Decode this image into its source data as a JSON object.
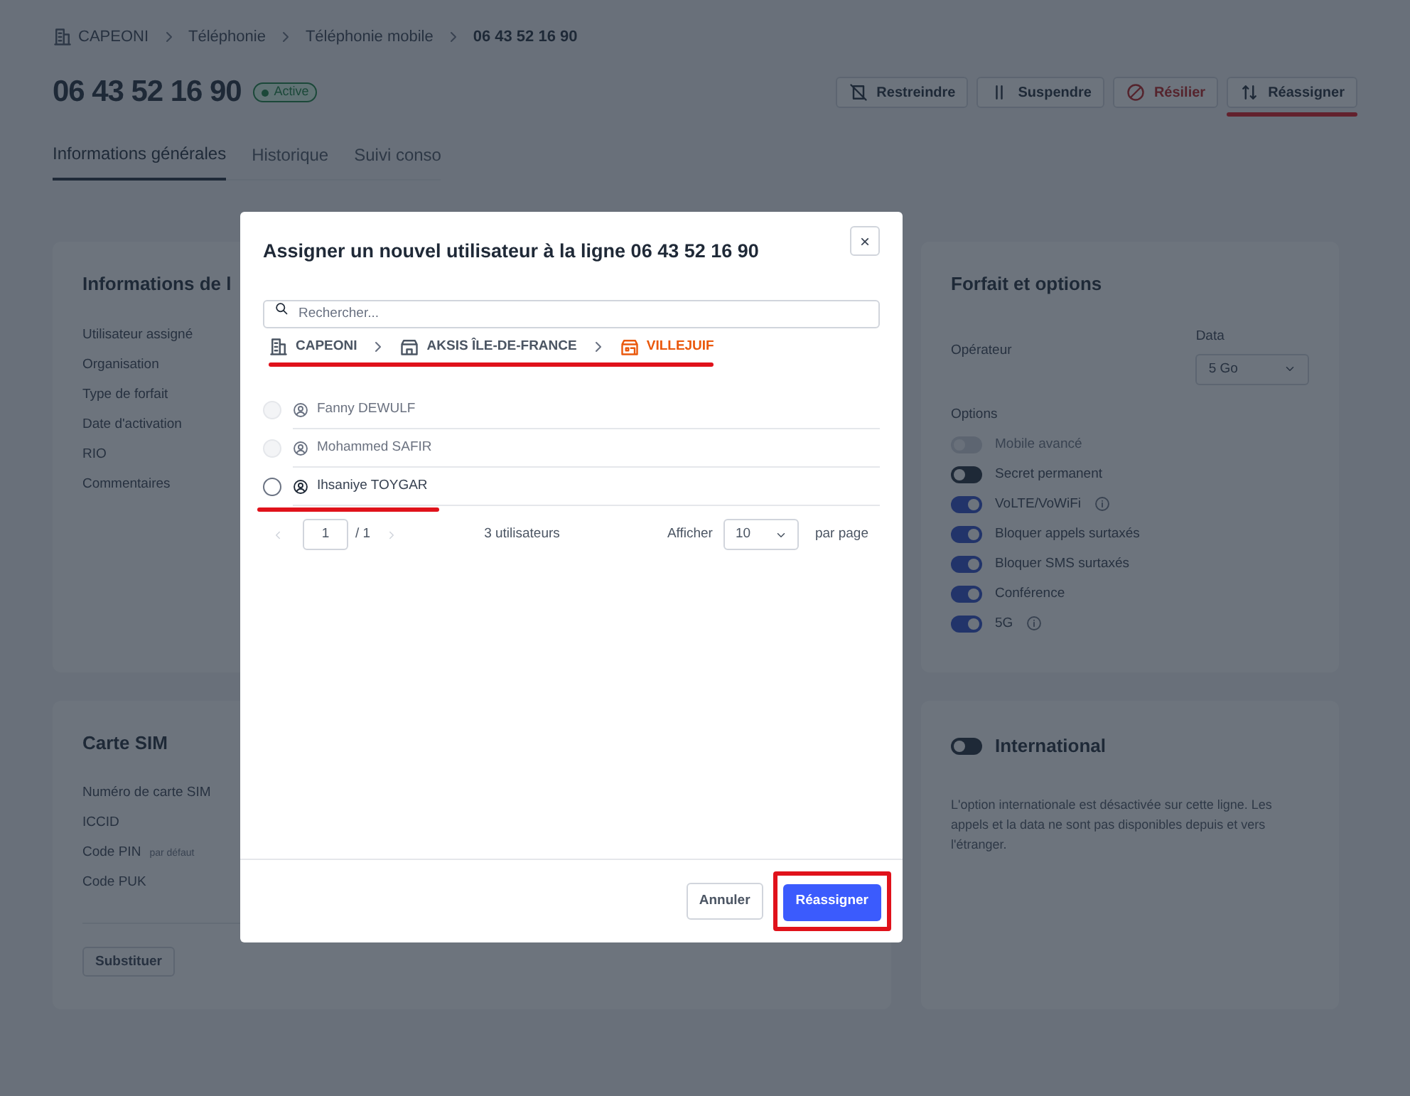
{
  "breadcrumb": [
    {
      "label": "CAPEONI",
      "kind": "building",
      "current": false
    },
    {
      "label": "Téléphonie",
      "current": false
    },
    {
      "label": "Téléphonie mobile",
      "current": false
    },
    {
      "label": "06 43 52 16 90",
      "current": true
    }
  ],
  "header": {
    "title": "06 43 52 16 90",
    "status": "Active",
    "actions": [
      {
        "label": "Restreindre",
        "kind": "restrict",
        "annotated": false
      },
      {
        "label": "Suspendre",
        "kind": "pause",
        "annotated": false
      },
      {
        "label": "Résilier",
        "kind": "cancel",
        "annotated": false
      },
      {
        "label": "Réassigner",
        "kind": "swap",
        "annotated": true
      }
    ]
  },
  "tabs": [
    {
      "label": "Informations générales",
      "selected": true
    },
    {
      "label": "Historique",
      "selected": false
    },
    {
      "label": "Suivi conso",
      "selected": false
    }
  ],
  "info_card": {
    "title": "Informations de l",
    "fields": [
      "Utilisateur assigné",
      "Organisation",
      "Type de forfait",
      "Date d'activation",
      "RIO",
      "Commentaires"
    ]
  },
  "sim_card": {
    "title": "Carte SIM",
    "fields": [
      {
        "label": "Numéro de carte SIM"
      },
      {
        "label": "ICCID"
      },
      {
        "label": "Code PIN",
        "hint": "par défaut"
      },
      {
        "label": "Code PUK"
      }
    ],
    "button": "Substituer"
  },
  "plan_card": {
    "title": "Forfait et options",
    "operator_label": "Opérateur",
    "data_label": "Data",
    "data_value": "5 Go",
    "options_label": "Options",
    "options": [
      {
        "label": "Mobile avancé",
        "on": false,
        "disabled": true,
        "info": false
      },
      {
        "label": "Secret permanent",
        "on": false,
        "disabled": false,
        "info": false
      },
      {
        "label": "VoLTE/VoWiFi",
        "on": true,
        "disabled": false,
        "info": true
      },
      {
        "label": "Bloquer appels surtaxés",
        "on": true,
        "disabled": false,
        "info": false
      },
      {
        "label": "Bloquer SMS surtaxés",
        "on": true,
        "disabled": false,
        "info": false
      },
      {
        "label": "Conférence",
        "on": true,
        "disabled": false,
        "info": false
      },
      {
        "label": "5G",
        "on": true,
        "disabled": false,
        "info": true
      }
    ]
  },
  "international_card": {
    "title": "International",
    "on": false,
    "text": "L'option internationale est désactivée sur cette ligne. Les appels et la data ne sont pas disponibles depuis et vers l'étranger."
  },
  "modal": {
    "title": "Assigner un nouvel utilisateur à la ligne 06 43 52 16 90",
    "close": "×",
    "search_placeholder": "Rechercher...",
    "path": [
      {
        "label": "CAPEONI",
        "kind": "building",
        "current": false
      },
      {
        "label": "AKSIS ÎLE-DE-FRANCE",
        "kind": "store",
        "current": false
      },
      {
        "label": "VILLEJUIF",
        "kind": "shop",
        "current": true
      }
    ],
    "path_annotated": true,
    "users": [
      {
        "name": "Fanny DEWULF",
        "disabled": true,
        "selected": false,
        "annotated": false
      },
      {
        "name": "Mohammed SAFIR",
        "disabled": true,
        "selected": false,
        "annotated": false
      },
      {
        "name": "Ihsaniye TOYGAR",
        "disabled": false,
        "selected": false,
        "annotated": true
      }
    ],
    "pagination": {
      "page": "1",
      "total": "/ 1",
      "count": "3 utilisateurs",
      "show_label": "Afficher",
      "per_page": "10",
      "per_page_label": "par page"
    },
    "cancel": "Annuler",
    "confirm": "Réassigner",
    "confirm_annotated": true
  }
}
